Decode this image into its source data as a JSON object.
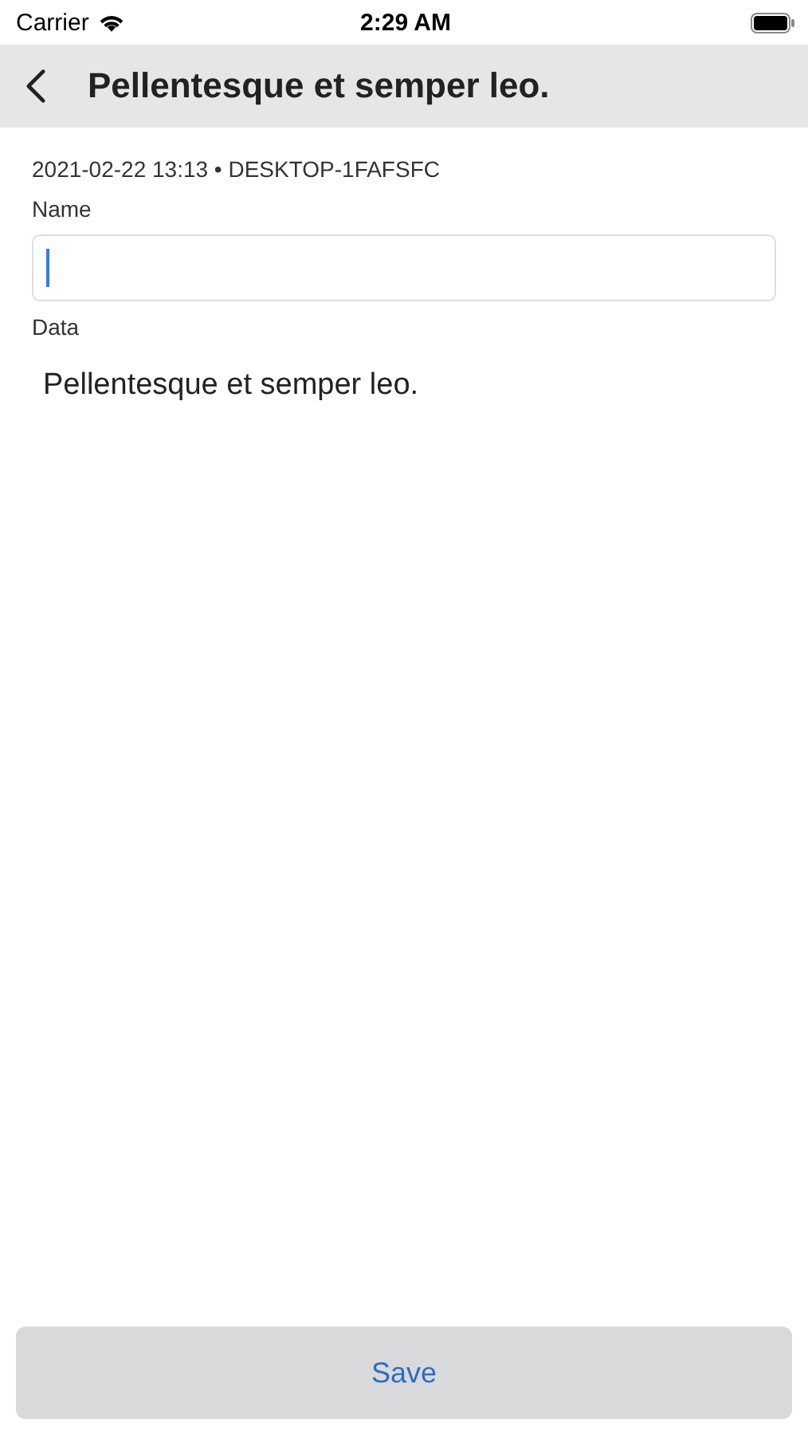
{
  "status_bar": {
    "carrier": "Carrier",
    "time": "2:29 AM"
  },
  "nav_bar": {
    "title": "Pellentesque et semper leo."
  },
  "meta": "2021-02-22 13:13 • DESKTOP-1FAFSFC",
  "name_field": {
    "label": "Name",
    "focused": true
  },
  "data_field": {
    "label": "Data",
    "value": "Pellentesque et semper leo."
  },
  "buttons": [
    {
      "label": "Save"
    }
  ]
}
